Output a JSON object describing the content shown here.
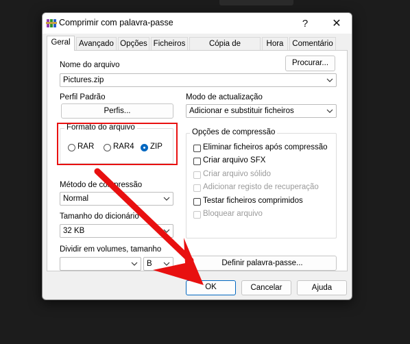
{
  "window": {
    "title": "Comprimir com palavra-passe",
    "help_symbol": "?",
    "close_symbol": "✕",
    "app_icon": "winrar-books-icon"
  },
  "tabs": [
    {
      "label": "Geral",
      "active": true
    },
    {
      "label": "Avançado"
    },
    {
      "label": "Opções"
    },
    {
      "label": "Ficheiros"
    },
    {
      "label": "Cópia de segurança"
    },
    {
      "label": "Hora"
    },
    {
      "label": "Comentário"
    }
  ],
  "general": {
    "archive_name_label": "Nome do arquivo",
    "browse_button": "Procurar...",
    "archive_name_value": "Pictures.zip",
    "profile_label": "Perfil Padrão",
    "profiles_button": "Perfis...",
    "update_mode_label": "Modo de actualização",
    "update_mode_value": "Adicionar e substituir ficheiros",
    "archive_format": {
      "title": "Formato do arquivo",
      "options": [
        "RAR",
        "RAR4",
        "ZIP"
      ],
      "selected": "ZIP"
    },
    "compression_method_label": "Método de compressão",
    "compression_method_value": "Normal",
    "dictionary_size_label": "Tamanho do dicionário",
    "dictionary_size_value": "32 KB",
    "split_volumes_label": "Dividir em volumes, tamanho",
    "split_volumes_value": "",
    "split_unit": "B",
    "set_password_button": "Definir palavra-passe...",
    "compression_options": {
      "title": "Opções de compressão",
      "items": [
        {
          "label": "Eliminar ficheiros após compressão",
          "checked": false,
          "enabled": true
        },
        {
          "label": "Criar arquivo SFX",
          "checked": false,
          "enabled": true
        },
        {
          "label": "Criar arquivo sólido",
          "checked": false,
          "enabled": false
        },
        {
          "label": "Adicionar registo de recuperação",
          "checked": false,
          "enabled": false
        },
        {
          "label": "Testar ficheiros comprimidos",
          "checked": false,
          "enabled": true
        },
        {
          "label": "Bloquear arquivo",
          "checked": false,
          "enabled": false
        }
      ]
    }
  },
  "footer": {
    "ok": "OK",
    "cancel": "Cancelar",
    "help": "Ajuda"
  },
  "annotations": {
    "highlight_color": "#e81010",
    "arrow_color": "#e81010"
  }
}
